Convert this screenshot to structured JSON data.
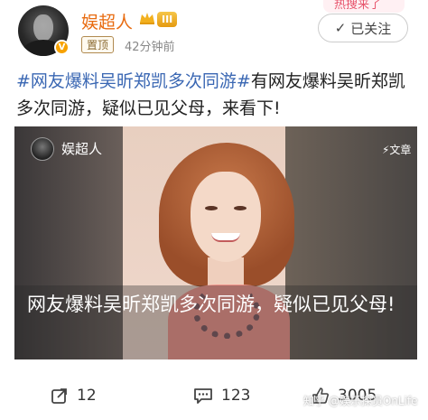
{
  "header": {
    "username": "娱超人",
    "level": "III",
    "verified_badge": "V",
    "pin_tag": "置顶",
    "time_ago": "42分钟前",
    "hot_tag": "热搜来了",
    "follow_label": "已关注",
    "accent_color": "#e86b10"
  },
  "post": {
    "hashtag": "#网友爆料吴昕郑凯多次同游#",
    "text": "有网友爆料吴昕郑凯多次同游，疑似已见父母，来看下!",
    "link_color": "#3a67b3"
  },
  "video_card": {
    "author": "娱超人",
    "tag": "⚡文章",
    "caption": "网友爆料吴昕郑凯多次同游，疑似已见父母!"
  },
  "actions": {
    "repost_count": "12",
    "comment_count": "123",
    "like_count": "3005",
    "watermark": "知乎 @娱乐探员OnLife"
  }
}
